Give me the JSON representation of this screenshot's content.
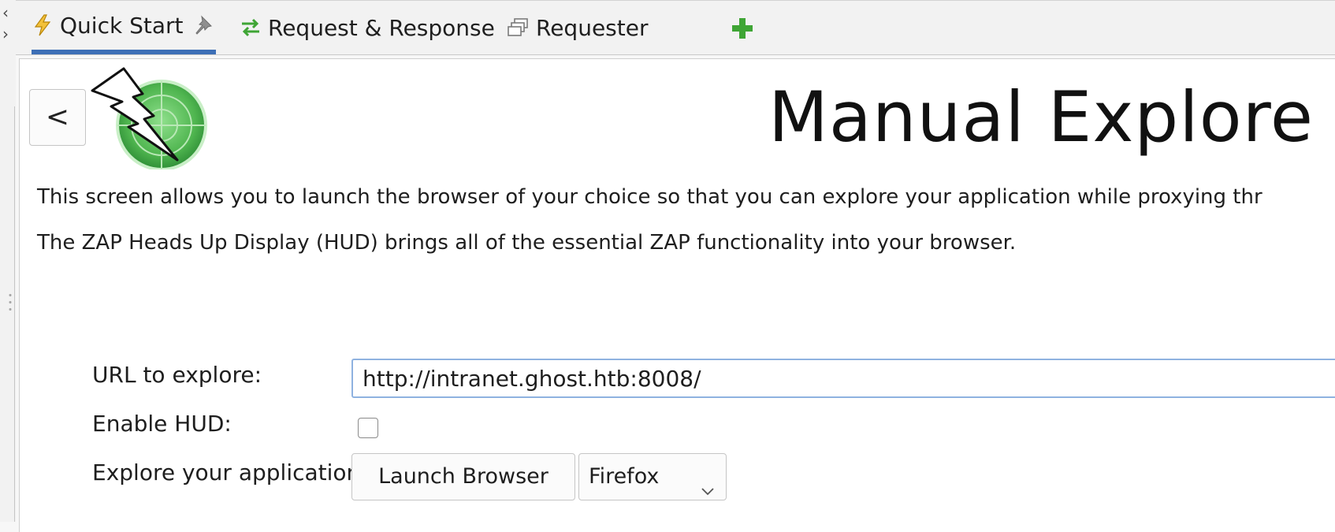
{
  "tabs": [
    {
      "label": "Quick Start",
      "icon": "lightning-icon",
      "active": true,
      "pinned": true
    },
    {
      "label": "Request & Response",
      "icon": "swap-arrows-icon"
    },
    {
      "label": "Requester",
      "icon": "window-stack-icon"
    }
  ],
  "add_tab_icon": "plus-icon",
  "page": {
    "back_label": "<",
    "title": "Manual Explore",
    "description_1": "This screen allows you to launch the browser of your choice so that you can explore your application while proxying thr",
    "description_2": "The ZAP Heads Up Display (HUD) brings all of the essential ZAP functionality into your browser."
  },
  "form": {
    "url_label": "URL to explore:",
    "url_value": "http://intranet.ghost.htb:8008/",
    "hud_label": "Enable HUD:",
    "hud_checked": false,
    "explore_label": "Explore your application:",
    "launch_label": "Launch Browser",
    "browser_value": "Firefox"
  },
  "colors": {
    "tab_accent": "#3d6fb6",
    "add_green": "#3fa535",
    "logo_green": "#5cbf5c"
  }
}
